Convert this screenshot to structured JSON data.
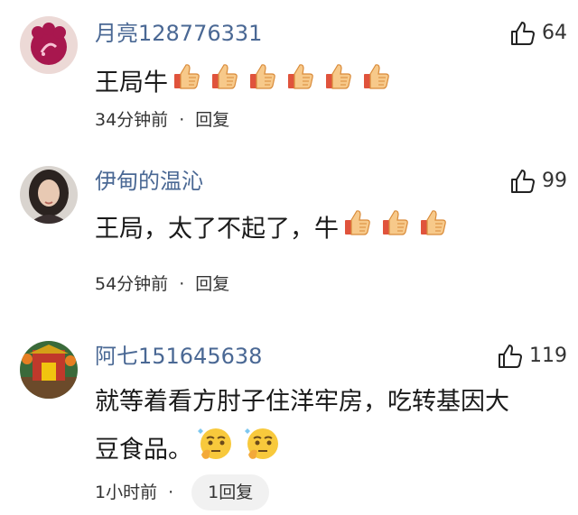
{
  "comments": [
    {
      "username": "月亮128776331",
      "likes": "64",
      "text": "王局牛",
      "emoji_name": "thumbs-up",
      "emoji_count": 6,
      "time": "34分钟前",
      "separator": "·",
      "reply": "回复"
    },
    {
      "username": "伊甸的温沁",
      "likes": "99",
      "text": "王局，太了不起了，牛",
      "emoji_name": "thumbs-up",
      "emoji_count": 3,
      "time": "54分钟前",
      "separator": "·",
      "reply": "回复"
    },
    {
      "username": "阿七151645638",
      "likes": "119",
      "text_line1": "就等着看方肘子住洋牢房，吃转基因大",
      "text_line2": "豆食品。",
      "emoji_name": "thinking-face",
      "emoji_count": 2,
      "time": "1小时前",
      "separator": "·",
      "reply": "1回复"
    }
  ],
  "colors": {
    "username": "#4a6894",
    "reply_pill_bg": "#f1f1f1"
  }
}
